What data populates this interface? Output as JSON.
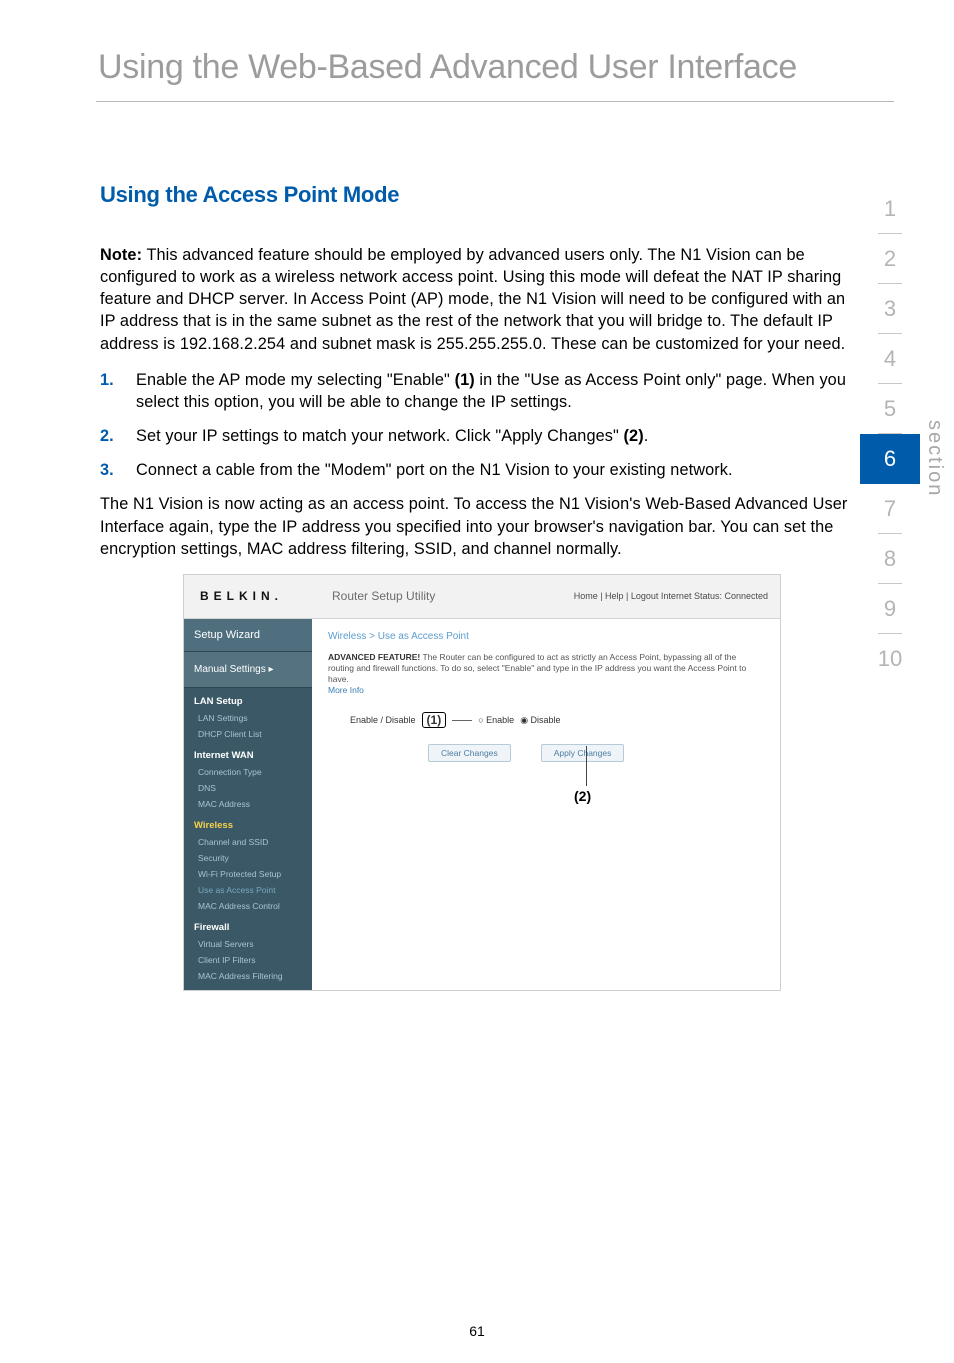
{
  "page": {
    "title": "Using the Web-Based Advanced User Interface",
    "number": "61"
  },
  "heading": "Using the Access Point Mode",
  "note_label": "Note:",
  "note_body": " This advanced feature should be employed by advanced users only. The N1 Vision can be configured to work as a wireless network access point. Using this mode will defeat the NAT IP sharing feature and DHCP server. In Access Point (AP) mode, the N1 Vision will need to be configured with an IP address that is in the same subnet as the rest of the network that you will bridge to. The default IP address is 192.168.2.254 and subnet mask is 255.255.255.0. These can be customized for your need.",
  "steps": [
    {
      "num": "1.",
      "pre": "Enable the AP mode my selecting \"Enable\" ",
      "ref": "(1)",
      "post": " in the \"Use as Access Point only\" page. When you select this option, you will be able to change the IP settings."
    },
    {
      "num": "2.",
      "pre": "Set your IP settings to match your network. Click \"Apply Changes\" ",
      "ref": "(2)",
      "post": "."
    },
    {
      "num": "3.",
      "pre": "Connect a cable from the \"Modem\" port on the N1 Vision to your existing network.",
      "ref": "",
      "post": ""
    }
  ],
  "after": "The N1 Vision is now acting as an access point. To access the N1 Vision's Web-Based Advanced User Interface again, type the IP address you specified into your browser's navigation bar. You can set the encryption settings, MAC address filtering, SSID, and channel normally.",
  "nav": {
    "items": [
      "1",
      "2",
      "3",
      "4",
      "5",
      "6",
      "7",
      "8",
      "9",
      "10"
    ],
    "active_index": 5,
    "label": "section"
  },
  "router": {
    "logo": "BELKIN.",
    "utility": "Router Setup Utility",
    "status": "Home | Help | Logout   Internet Status: Connected",
    "wizard": "Setup Wizard",
    "manual": "Manual Settings ▸",
    "sidebar": [
      {
        "type": "cat",
        "label": "LAN Setup"
      },
      {
        "type": "itm",
        "label": "LAN Settings"
      },
      {
        "type": "itm",
        "label": "DHCP Client List"
      },
      {
        "type": "cat",
        "label": "Internet WAN"
      },
      {
        "type": "itm",
        "label": "Connection Type"
      },
      {
        "type": "itm",
        "label": "DNS"
      },
      {
        "type": "itm",
        "label": "MAC Address"
      },
      {
        "type": "catwl",
        "label": "Wireless"
      },
      {
        "type": "itm",
        "label": "Channel and SSID"
      },
      {
        "type": "itm",
        "label": "Security"
      },
      {
        "type": "itm",
        "label": "Wi-Fi Protected Setup"
      },
      {
        "type": "itmsel",
        "label": "Use as Access Point"
      },
      {
        "type": "itm",
        "label": "MAC Address Control"
      },
      {
        "type": "cat",
        "label": "Firewall"
      },
      {
        "type": "itm",
        "label": "Virtual Servers"
      },
      {
        "type": "itm",
        "label": "Client IP Filters"
      },
      {
        "type": "itm",
        "label": "MAC Address Filtering"
      }
    ],
    "breadcrumb": "Wireless > Use as Access Point",
    "desc_bold": "ADVANCED FEATURE!",
    "desc": " The Router can be configured to act as strictly an Access Point, bypassing all of the routing and firewall functions. To do so, select \"Enable\" and type in the IP address you want the Access Point to have.",
    "more": "More Info",
    "enable_label": "Enable / Disable",
    "callout1": "(1)",
    "radio_enable": "Enable",
    "radio_disable": "Disable",
    "btn_clear": "Clear Changes",
    "btn_apply": "Apply Changes",
    "callout2": "(2)"
  }
}
